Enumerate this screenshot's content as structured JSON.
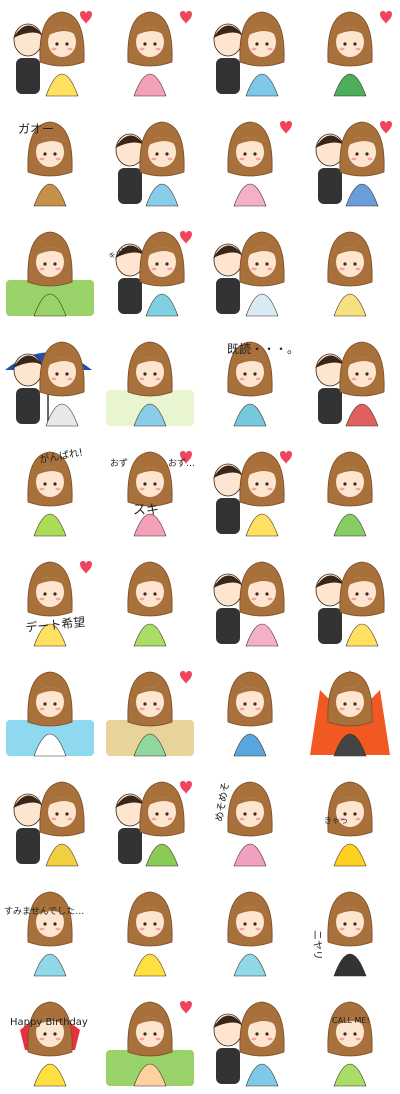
{
  "stickers": [
    {
      "text": ""
    },
    {
      "text": ""
    },
    {
      "text": ""
    },
    {
      "text": ""
    },
    {
      "text": "ガオー"
    },
    {
      "text": ""
    },
    {
      "text": ""
    },
    {
      "text": ""
    },
    {
      "text": ""
    },
    {
      "text": "キュン"
    },
    {
      "text": ""
    },
    {
      "text": ""
    },
    {
      "text": ""
    },
    {
      "text": ""
    },
    {
      "text": "既読・・・。"
    },
    {
      "text": ""
    },
    {
      "text": "がんばれ!"
    },
    {
      "text": "スキ"
    },
    {
      "text": ""
    },
    {
      "text": ""
    },
    {
      "text": "デート希望"
    },
    {
      "text": ""
    },
    {
      "text": ""
    },
    {
      "text": ""
    },
    {
      "text": ""
    },
    {
      "text": ""
    },
    {
      "text": ""
    },
    {
      "text": ""
    },
    {
      "text": ""
    },
    {
      "text": ""
    },
    {
      "text": "めそめそ"
    },
    {
      "text": "きゃっ"
    },
    {
      "text": "すみませんでした…"
    },
    {
      "text": ""
    },
    {
      "text": ""
    },
    {
      "text": "ニヤリ"
    },
    {
      "text": "Happy Birthday"
    },
    {
      "text": ""
    },
    {
      "text": ""
    },
    {
      "text": "CALL ME!"
    }
  ],
  "extra_labels": {
    "ozu1": "おず",
    "ozu2": "おず…"
  },
  "colors": {
    "hair": "#a8703a",
    "hair_dark": "#7a4a22",
    "skin": "#fde5d0",
    "heart": "#f0435c",
    "outline": "#3a2a1e"
  }
}
